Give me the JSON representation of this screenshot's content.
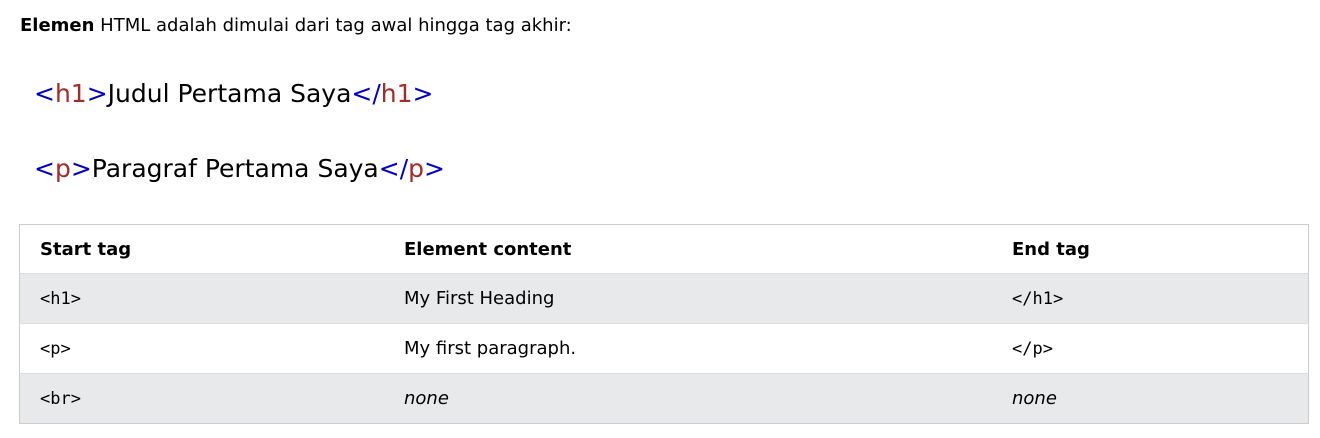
{
  "intro": {
    "bold": "Elemen",
    "rest": " HTML adalah dimulai dari tag awal hingga tag akhir:"
  },
  "examples": [
    {
      "open_lt": "<",
      "open_tag": "h1",
      "open_gt": ">",
      "content": "Judul Pertama Saya",
      "close_lt": "</",
      "close_tag": "h1",
      "close_gt": ">"
    },
    {
      "open_lt": "<",
      "open_tag": "p",
      "open_gt": ">",
      "content": "Paragraf Pertama Saya",
      "close_lt": "</",
      "close_tag": "p",
      "close_gt": ">"
    }
  ],
  "table": {
    "headers": [
      "Start tag",
      "Element content",
      "End tag"
    ],
    "rows": [
      [
        "<h1>",
        "My First Heading",
        "</h1>"
      ],
      [
        "<p>",
        "My first paragraph.",
        "</p>"
      ],
      [
        "<br>",
        "none",
        "none"
      ]
    ]
  },
  "colors": {
    "tag_bracket": "#0000cd",
    "tag_name": "#a52a2a",
    "row_stripe": "#e7e9eb",
    "table_border": "#cccccc"
  }
}
